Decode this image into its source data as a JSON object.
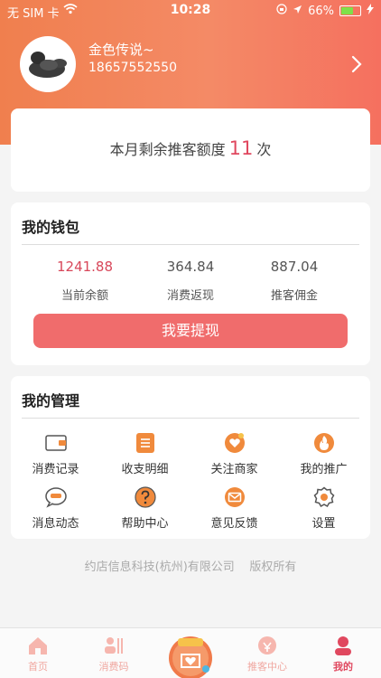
{
  "status_bar": {
    "carrier": "无 SIM 卡",
    "time": "10:28",
    "battery": "66%",
    "battery_level": 0.66
  },
  "profile": {
    "name": "金色传说~",
    "phone": "18657552550"
  },
  "quota": {
    "prefix": "本月剩余推客额度",
    "count": "11",
    "suffix": "次"
  },
  "wallet": {
    "title": "我的钱包",
    "stats": [
      {
        "value": "1241.88",
        "label": "当前余额"
      },
      {
        "value": "364.84",
        "label": "消费返现"
      },
      {
        "value": "887.04",
        "label": "推客佣金"
      }
    ],
    "withdraw_label": "我要提现"
  },
  "management": {
    "title": "我的管理",
    "items": [
      {
        "label": "消费记录",
        "icon": "wallet-icon"
      },
      {
        "label": "收支明细",
        "icon": "ledger-icon"
      },
      {
        "label": "关注商家",
        "icon": "favorite-shop-icon"
      },
      {
        "label": "我的推广",
        "icon": "promotion-icon"
      },
      {
        "label": "消息动态",
        "icon": "message-icon"
      },
      {
        "label": "帮助中心",
        "icon": "help-icon"
      },
      {
        "label": "意见反馈",
        "icon": "feedback-icon"
      },
      {
        "label": "设置",
        "icon": "settings-icon"
      }
    ]
  },
  "footer": {
    "company": "约店信息科技(杭州)有限公司",
    "rights": "版权所有"
  },
  "tabbar": {
    "tabs": [
      {
        "label": "首页",
        "icon": "home-icon"
      },
      {
        "label": "消费码",
        "icon": "consume-code-icon"
      },
      {
        "label": "推客中心",
        "icon": "promoter-center-icon"
      },
      {
        "label": "我的",
        "icon": "profile-icon",
        "active": true
      }
    ],
    "center": {
      "icon": "center-shop-icon"
    }
  },
  "colors": {
    "header_start": "#f07f4e",
    "header_end": "#f5705f",
    "accent_red": "#e0485f",
    "button": "#f06c6c",
    "icon_orange": "#f08a3c"
  }
}
